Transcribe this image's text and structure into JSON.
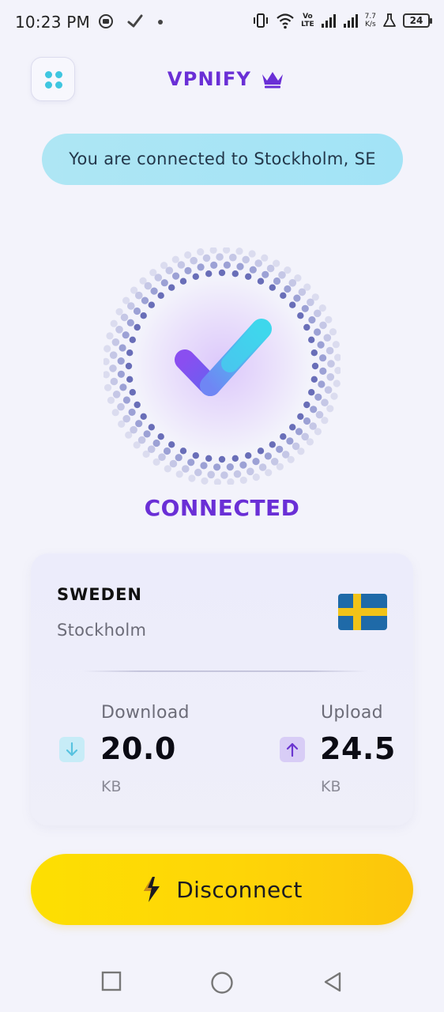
{
  "status_bar": {
    "time": "10:23 PM",
    "net_speed_value": "7.7",
    "net_speed_unit": "K/s",
    "volte_top": "Vo",
    "volte_bottom": "LTE",
    "battery": "24"
  },
  "header": {
    "brand": "VPNIFY",
    "menu_icon": "grid-dots-icon",
    "premium_icon": "crown-icon"
  },
  "banner": {
    "text": "You are connected to Stockholm, SE"
  },
  "connection": {
    "status": "CONNECTED",
    "icon": "checkmark-icon"
  },
  "server_card": {
    "country": "SWEDEN",
    "city": "Stockholm",
    "flag_icon": "sweden-flag-icon",
    "download": {
      "label": "Download",
      "value": "20.0",
      "unit": "KB",
      "icon": "arrow-down-icon"
    },
    "upload": {
      "label": "Upload",
      "value": "24.5",
      "unit": "KB",
      "icon": "arrow-up-icon"
    }
  },
  "actions": {
    "disconnect_label": "Disconnect",
    "disconnect_icon": "lightning-icon"
  },
  "nav": {
    "recents_icon": "square-icon",
    "home_icon": "circle-icon",
    "back_icon": "triangle-back-icon"
  },
  "colors": {
    "brand_purple": "#6a2fd6",
    "banner_cyan": "#a8e4f5",
    "button_yellow": "#fed507",
    "background": "#f3f3fb"
  }
}
